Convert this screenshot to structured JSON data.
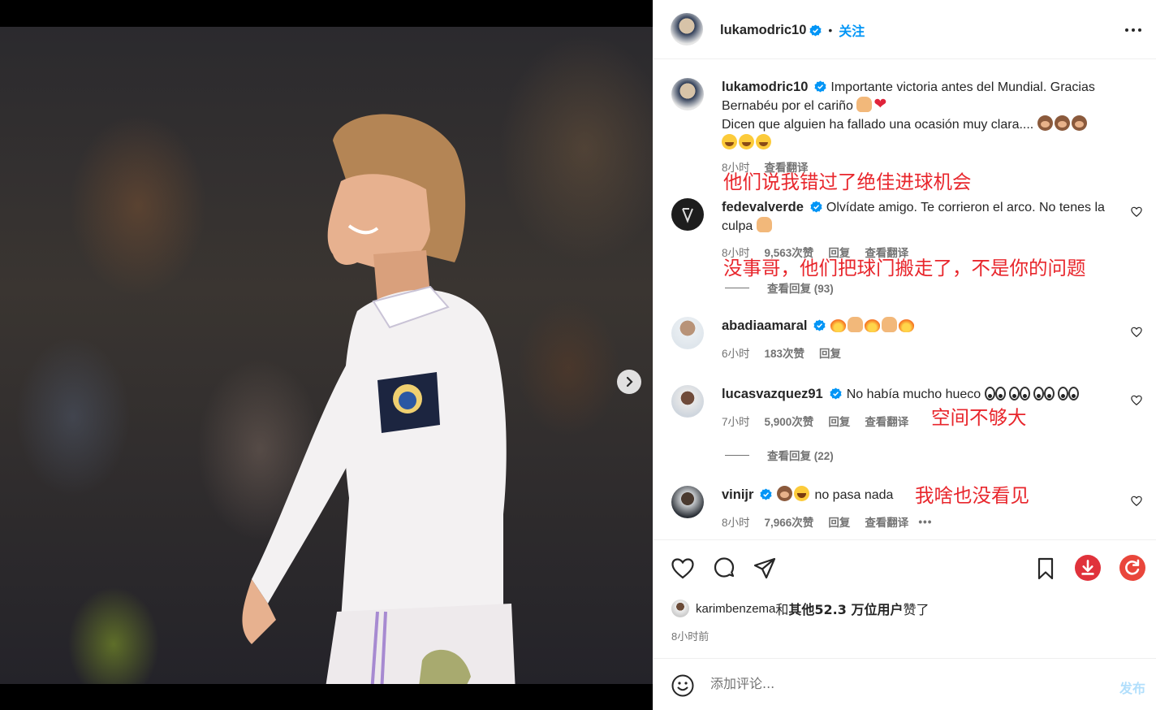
{
  "post": {
    "author": "lukamodric10",
    "follow_label": "关注",
    "separator": "•",
    "image_alt": "Luka Modric smiling on the pitch",
    "carousel_count": 2,
    "carousel_index": 0
  },
  "caption": {
    "username": "lukamodric10",
    "text_1": "Importante victoria antes del Mundial. Gracias Bernabéu por el cariño",
    "text_2": "Dicen que alguien ha fallado una ocasión muy clara....",
    "time": "8小时",
    "translate": "查看翻译",
    "translation_overlay": "他们说我错过了绝佳进球机会"
  },
  "comments": [
    {
      "username": "fedevalverde",
      "text": "Olvídate amigo. Te corrieron el arco. No tenes la culpa",
      "time": "8小时",
      "likes": "9,563次赞",
      "reply": "回复",
      "translate": "查看翻译",
      "translation_overlay": "没事哥，他们把球门搬走了，不是你的问题",
      "view_replies": "查看回复 (93)"
    },
    {
      "username": "abadiaamaral",
      "text": "",
      "time": "6小时",
      "likes": "183次赞",
      "reply": "回复"
    },
    {
      "username": "lucasvazquez91",
      "text": "No había mucho hueco",
      "time": "7小时",
      "likes": "5,900次赞",
      "reply": "回复",
      "translate": "查看翻译",
      "translation_overlay": "空间不够大",
      "view_replies": "查看回复 (22)"
    },
    {
      "username": "vinijr",
      "text": "no pasa nada",
      "time": "8小时",
      "likes": "7,966次赞",
      "reply": "回复",
      "translate": "查看翻译",
      "more": "•••",
      "translation_overlay": "我啥也没看见"
    }
  ],
  "likes": {
    "liker": "karimbenzema",
    "and": "和",
    "others": "其他52.3 万位用户",
    "suffix": "赞了"
  },
  "posted_ago": "8小时前",
  "composer": {
    "placeholder": "添加评论...",
    "post_label": "发布"
  },
  "colors": {
    "verified": "#0095f6",
    "link": "#0095f6",
    "annotation": "#e8262c",
    "download_badge": "#e0323b",
    "refresh_badge": "#e9463b"
  },
  "icons": [
    "more-icon",
    "heart-icon",
    "comment-icon",
    "share-icon",
    "bookmark-icon",
    "download-icon",
    "refresh-icon",
    "emoji-icon",
    "chevron-right-icon",
    "verified-icon"
  ]
}
